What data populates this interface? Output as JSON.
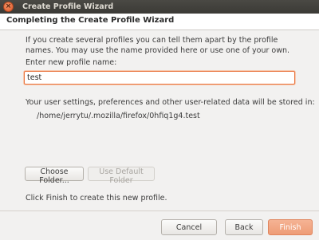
{
  "window": {
    "title": "Create Profile Wizard"
  },
  "header": {
    "title": "Completing the Create Profile Wizard"
  },
  "main": {
    "intro": "If you create several profiles you can tell them apart by the profile names. You may use the name provided here or use one of your own.",
    "name_label": "Enter new profile name:",
    "name_value": "test",
    "storage_text": "Your user settings, preferences and other user-related data will be stored in:",
    "storage_path": "/home/jerrytu/.mozilla/firefox/0hfiq1g4.test",
    "choose_folder_label": "Choose Folder...",
    "use_default_label": "Use Default Folder",
    "finish_hint": "Click Finish to create this new profile."
  },
  "footer": {
    "cancel_label": "Cancel",
    "back_label": "Back",
    "finish_label": "Finish"
  },
  "colors": {
    "accent": "#e9743f",
    "finish_button": "#ee9c76",
    "titlebar": "#3c3b37"
  },
  "icons": {
    "close": "close-icon"
  }
}
